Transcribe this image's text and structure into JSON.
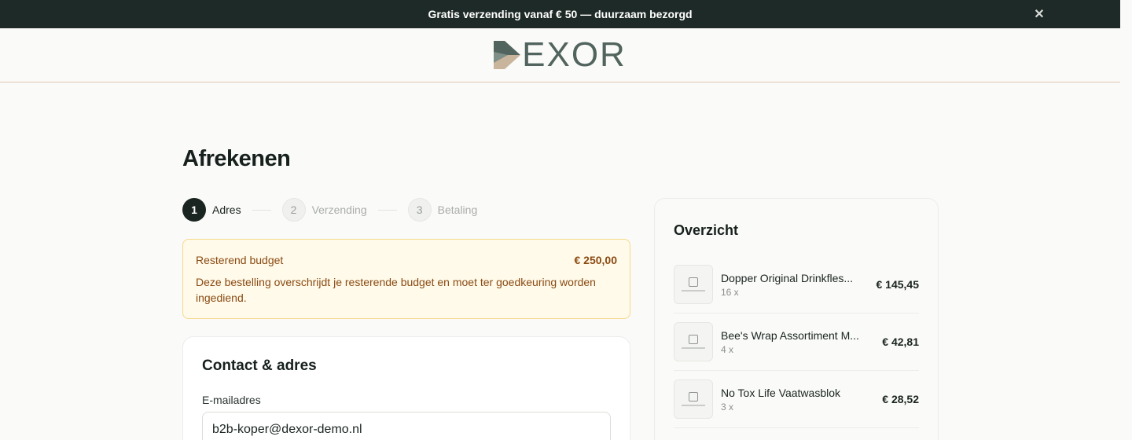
{
  "announcement": {
    "text": "Gratis verzending vanaf € 50 — duurzaam bezorgd",
    "close_icon": "close-icon"
  },
  "brand": {
    "name": "EXOR",
    "mark_colors": [
      "#51645d",
      "#c9b49c"
    ]
  },
  "checkout": {
    "title": "Afrekenen",
    "steps": [
      {
        "number": "1",
        "label": "Adres",
        "active": true
      },
      {
        "number": "2",
        "label": "Verzending",
        "active": false
      },
      {
        "number": "3",
        "label": "Betaling",
        "active": false
      }
    ],
    "budget_alert": {
      "label": "Resterend budget",
      "amount": "€ 250,00",
      "message": "Deze bestelling overschrijdt je resterende budget en moet ter goedkeuring worden ingediend."
    },
    "contact": {
      "title": "Contact & adres",
      "email_label": "E-mailadres",
      "email_value": "b2b-koper@dexor-demo.nl"
    }
  },
  "summary": {
    "title": "Overzicht",
    "items": [
      {
        "name": "Dopper Original Drinkfles...",
        "qty": "16 x",
        "price": "€ 145,45"
      },
      {
        "name": "Bee's Wrap Assortiment M...",
        "qty": "4 x",
        "price": "€ 42,81"
      },
      {
        "name": "No Tox Life Vaatwasblok",
        "qty": "3 x",
        "price": "€ 28,52"
      }
    ]
  }
}
